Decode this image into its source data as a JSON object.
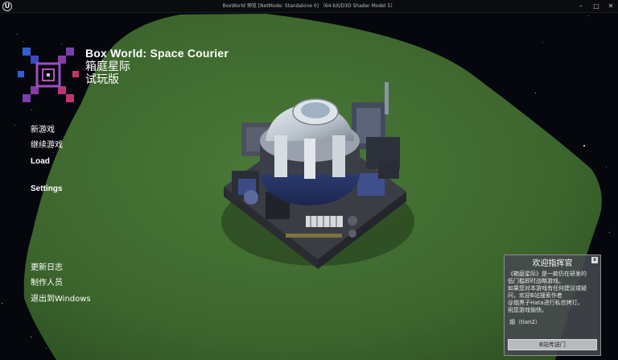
{
  "window": {
    "title": "BoxWorld 预览 [NetMode: Standalone 0]  （64-bit/D3D Shader Model 5）",
    "minimize_glyph": "–",
    "maximize_glyph": "□",
    "close_glyph": "✕",
    "app_icon": "unreal-engine-icon",
    "app_icon_glyph": "U"
  },
  "game": {
    "title_en": "Box World: Space Courier",
    "title_cn": "箱庭星际",
    "edition": "试玩版"
  },
  "menu": {
    "new_game": "新游戏",
    "continue": "继续游戏",
    "load": "Load",
    "settings": "Settings",
    "changelog": "更新日志",
    "credits": "制作人员",
    "exit": "退出到Windows"
  },
  "welcome_panel": {
    "title": "欢迎指挥官",
    "close_label": "x",
    "lines": [
      "《箱庭星际》是一款仍在研发的",
      "低门槛即时战略游戏。",
      "如果您对本游戏有任何建议或疑",
      "问，欢迎B站搜索作者",
      "@烟黑子Hata进行私信拷打。",
      "祝您游戏愉快。"
    ],
    "signature": "烟（tian2）",
    "button_label": "B站传送门"
  },
  "colors": {
    "space": "#05070c",
    "grass": "#3f6a30",
    "panel": "#46484e",
    "logo_blue": "#2f5fd6",
    "logo_purple": "#7a3fb0",
    "logo_red": "#c0366a"
  }
}
